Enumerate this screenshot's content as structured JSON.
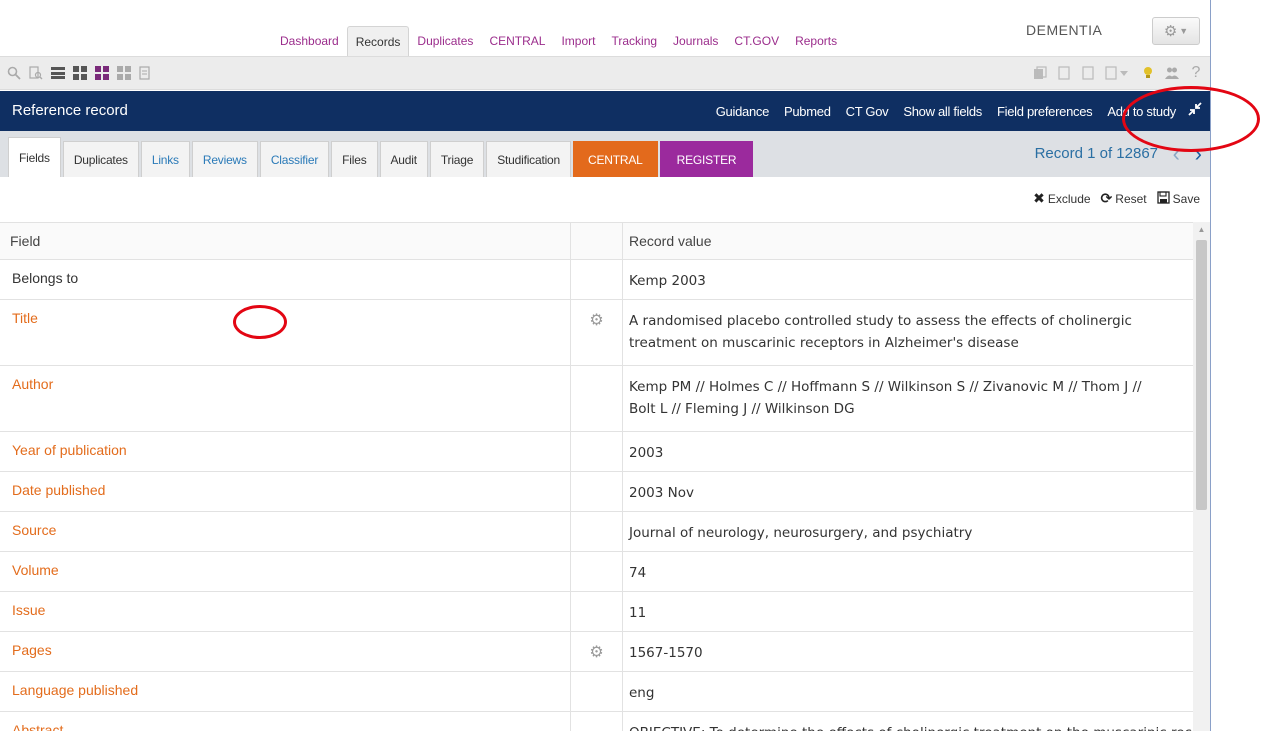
{
  "topnav": {
    "tabs": [
      "Dashboard",
      "Records",
      "Duplicates",
      "CENTRAL",
      "Import",
      "Tracking",
      "Journals",
      "CT.GOV",
      "Reports"
    ],
    "active_tab": "Records",
    "project_name": "DEMENTIA"
  },
  "reference_bar": {
    "title": "Reference record",
    "links": [
      "Guidance",
      "Pubmed",
      "CT Gov",
      "Show all fields",
      "Field preferences",
      "Add to study"
    ]
  },
  "record_tabs": {
    "tabs": [
      "Fields",
      "Duplicates",
      "Links",
      "Reviews",
      "Classifier",
      "Files",
      "Audit",
      "Triage",
      "Studification"
    ],
    "central": "CENTRAL",
    "register": "REGISTER",
    "record_count": "Record 1 of 12867"
  },
  "actions": {
    "exclude": "Exclude",
    "reset": "Reset",
    "save": "Save"
  },
  "table": {
    "headers": [
      "Field",
      "Record value"
    ],
    "rows": [
      {
        "field": "Belongs to",
        "value": "Kemp 2003"
      },
      {
        "field": "Title",
        "value": "A randomised placebo controlled study to assess the effects of cholinergic treatment on muscarinic receptors in Alzheimer's disease"
      },
      {
        "field": "Author",
        "value": "Kemp PM // Holmes C // Hoffmann S // Wilkinson S // Zivanovic M // Thom J // Bolt L // Fleming J // Wilkinson DG"
      },
      {
        "field": "Year of publication",
        "value": "2003"
      },
      {
        "field": "Date published",
        "value": "2003 Nov"
      },
      {
        "field": "Source",
        "value": "Journal of neurology, neurosurgery, and psychiatry"
      },
      {
        "field": "Volume",
        "value": "74"
      },
      {
        "field": "Issue",
        "value": "11"
      },
      {
        "field": "Pages",
        "value": "1567-1570"
      },
      {
        "field": "Language published",
        "value": "eng"
      },
      {
        "field": "Abstract",
        "value": "OBJECTIVE: To determine the effects of cholinergic treatment on the muscarinic receptor in patients with"
      }
    ]
  },
  "colors": {
    "nav_link": "#9b2d8c",
    "ref_bar": "#0f2f62",
    "field_orange": "#e36c1c",
    "central": "#e36a1c",
    "register": "#9b2a9d",
    "annotation_circle": "#e30613"
  }
}
